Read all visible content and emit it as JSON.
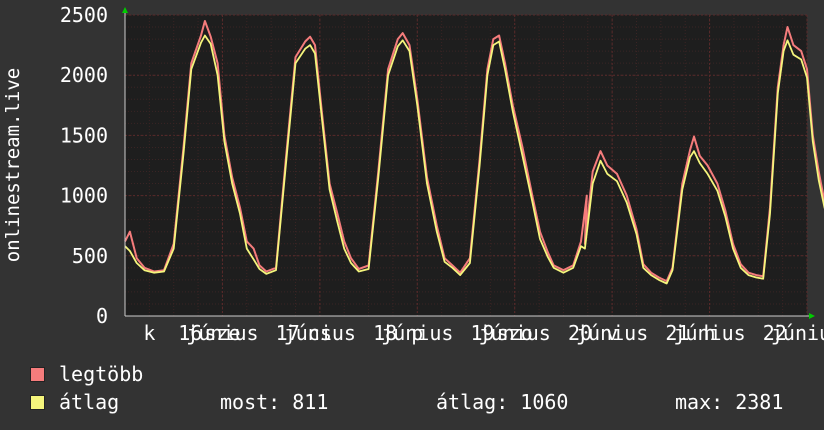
{
  "chart_data": {
    "type": "line",
    "ylabel": "onlinestream.live",
    "ylim": [
      0,
      2500
    ],
    "yticks": [
      0,
      500,
      1000,
      1500,
      2000,
      2500
    ],
    "xlim": [
      0,
      7
    ],
    "x_tick_labels": [
      {
        "x": 0.25,
        "label": "k"
      },
      {
        "x": 0.67,
        "label": "16"
      },
      {
        "x": 1.0,
        "label": "június"
      },
      {
        "x": 1.0,
        "label": "sze"
      },
      {
        "x": 1.67,
        "label": "17"
      },
      {
        "x": 2.0,
        "label": "június"
      },
      {
        "x": 2.0,
        "label": "cs"
      },
      {
        "x": 2.67,
        "label": "18"
      },
      {
        "x": 3.0,
        "label": "június"
      },
      {
        "x": 3.0,
        "label": "p"
      },
      {
        "x": 3.67,
        "label": "19"
      },
      {
        "x": 4.0,
        "label": "június"
      },
      {
        "x": 4.0,
        "label": "szo"
      },
      {
        "x": 4.67,
        "label": "20"
      },
      {
        "x": 5.0,
        "label": "június"
      },
      {
        "x": 5.0,
        "label": "v"
      },
      {
        "x": 5.67,
        "label": "21"
      },
      {
        "x": 6.0,
        "label": "június"
      },
      {
        "x": 6.0,
        "label": "h"
      },
      {
        "x": 6.67,
        "label": "22"
      },
      {
        "x": 7.0,
        "label": "június"
      }
    ],
    "grid": true,
    "series": [
      {
        "name": "legtöbb",
        "color": "#f57c7c",
        "points": [
          [
            0.0,
            620
          ],
          [
            0.05,
            700
          ],
          [
            0.12,
            480
          ],
          [
            0.2,
            400
          ],
          [
            0.3,
            370
          ],
          [
            0.4,
            380
          ],
          [
            0.5,
            600
          ],
          [
            0.6,
            1400
          ],
          [
            0.68,
            2100
          ],
          [
            0.78,
            2330
          ],
          [
            0.82,
            2450
          ],
          [
            0.88,
            2320
          ],
          [
            0.95,
            2100
          ],
          [
            1.02,
            1500
          ],
          [
            1.1,
            1150
          ],
          [
            1.18,
            900
          ],
          [
            1.25,
            620
          ],
          [
            1.32,
            560
          ],
          [
            1.38,
            420
          ],
          [
            1.45,
            370
          ],
          [
            1.55,
            400
          ],
          [
            1.65,
            1300
          ],
          [
            1.75,
            2150
          ],
          [
            1.85,
            2280
          ],
          [
            1.9,
            2320
          ],
          [
            1.95,
            2250
          ],
          [
            2.02,
            1700
          ],
          [
            2.1,
            1100
          ],
          [
            2.18,
            850
          ],
          [
            2.25,
            620
          ],
          [
            2.32,
            480
          ],
          [
            2.4,
            390
          ],
          [
            2.5,
            420
          ],
          [
            2.6,
            1200
          ],
          [
            2.7,
            2050
          ],
          [
            2.8,
            2300
          ],
          [
            2.85,
            2350
          ],
          [
            2.92,
            2250
          ],
          [
            3.0,
            1800
          ],
          [
            3.1,
            1150
          ],
          [
            3.2,
            750
          ],
          [
            3.28,
            480
          ],
          [
            3.36,
            420
          ],
          [
            3.44,
            360
          ],
          [
            3.54,
            480
          ],
          [
            3.64,
            1300
          ],
          [
            3.72,
            2050
          ],
          [
            3.78,
            2300
          ],
          [
            3.84,
            2330
          ],
          [
            3.9,
            2100
          ],
          [
            3.98,
            1750
          ],
          [
            4.08,
            1400
          ],
          [
            4.18,
            1000
          ],
          [
            4.26,
            700
          ],
          [
            4.34,
            530
          ],
          [
            4.4,
            420
          ],
          [
            4.5,
            380
          ],
          [
            4.6,
            420
          ],
          [
            4.68,
            620
          ],
          [
            4.74,
            1000
          ],
          [
            4.72,
            600
          ],
          [
            4.8,
            1200
          ],
          [
            4.88,
            1370
          ],
          [
            4.95,
            1250
          ],
          [
            5.05,
            1180
          ],
          [
            5.15,
            1000
          ],
          [
            5.25,
            720
          ],
          [
            5.32,
            430
          ],
          [
            5.4,
            360
          ],
          [
            5.48,
            320
          ],
          [
            5.56,
            290
          ],
          [
            5.62,
            400
          ],
          [
            5.72,
            1100
          ],
          [
            5.8,
            1380
          ],
          [
            5.84,
            1490
          ],
          [
            5.9,
            1330
          ],
          [
            5.98,
            1250
          ],
          [
            6.08,
            1100
          ],
          [
            6.16,
            880
          ],
          [
            6.24,
            600
          ],
          [
            6.32,
            430
          ],
          [
            6.4,
            360
          ],
          [
            6.48,
            340
          ],
          [
            6.55,
            330
          ],
          [
            6.62,
            900
          ],
          [
            6.7,
            1900
          ],
          [
            6.76,
            2250
          ],
          [
            6.8,
            2400
          ],
          [
            6.86,
            2250
          ],
          [
            6.94,
            2200
          ],
          [
            7.0,
            2050
          ],
          [
            7.06,
            1500
          ],
          [
            7.12,
            1200
          ],
          [
            7.18,
            950
          ],
          [
            7.22,
            850
          ]
        ]
      },
      {
        "name": "átlag",
        "color": "#f5f57c",
        "points": [
          [
            0.0,
            580
          ],
          [
            0.05,
            540
          ],
          [
            0.12,
            440
          ],
          [
            0.2,
            380
          ],
          [
            0.3,
            360
          ],
          [
            0.4,
            370
          ],
          [
            0.5,
            560
          ],
          [
            0.6,
            1350
          ],
          [
            0.68,
            2050
          ],
          [
            0.78,
            2270
          ],
          [
            0.82,
            2330
          ],
          [
            0.88,
            2260
          ],
          [
            0.95,
            2000
          ],
          [
            1.02,
            1450
          ],
          [
            1.1,
            1100
          ],
          [
            1.18,
            850
          ],
          [
            1.25,
            560
          ],
          [
            1.32,
            470
          ],
          [
            1.38,
            390
          ],
          [
            1.45,
            350
          ],
          [
            1.55,
            380
          ],
          [
            1.65,
            1250
          ],
          [
            1.75,
            2100
          ],
          [
            1.85,
            2220
          ],
          [
            1.9,
            2250
          ],
          [
            1.95,
            2180
          ],
          [
            2.02,
            1650
          ],
          [
            2.1,
            1050
          ],
          [
            2.18,
            780
          ],
          [
            2.25,
            560
          ],
          [
            2.32,
            440
          ],
          [
            2.4,
            370
          ],
          [
            2.5,
            390
          ],
          [
            2.6,
            1150
          ],
          [
            2.7,
            2000
          ],
          [
            2.8,
            2240
          ],
          [
            2.85,
            2290
          ],
          [
            2.92,
            2200
          ],
          [
            3.0,
            1750
          ],
          [
            3.1,
            1100
          ],
          [
            3.2,
            700
          ],
          [
            3.28,
            450
          ],
          [
            3.36,
            400
          ],
          [
            3.44,
            340
          ],
          [
            3.54,
            440
          ],
          [
            3.64,
            1250
          ],
          [
            3.72,
            2000
          ],
          [
            3.78,
            2250
          ],
          [
            3.84,
            2280
          ],
          [
            3.9,
            2050
          ],
          [
            3.98,
            1700
          ],
          [
            4.08,
            1330
          ],
          [
            4.18,
            950
          ],
          [
            4.26,
            640
          ],
          [
            4.34,
            490
          ],
          [
            4.4,
            400
          ],
          [
            4.5,
            360
          ],
          [
            4.6,
            400
          ],
          [
            4.68,
            580
          ],
          [
            4.72,
            560
          ],
          [
            4.8,
            1100
          ],
          [
            4.88,
            1290
          ],
          [
            4.95,
            1180
          ],
          [
            5.05,
            1120
          ],
          [
            5.15,
            940
          ],
          [
            5.25,
            680
          ],
          [
            5.32,
            400
          ],
          [
            5.4,
            340
          ],
          [
            5.48,
            300
          ],
          [
            5.56,
            270
          ],
          [
            5.62,
            380
          ],
          [
            5.72,
            1050
          ],
          [
            5.8,
            1320
          ],
          [
            5.84,
            1370
          ],
          [
            5.9,
            1270
          ],
          [
            5.98,
            1180
          ],
          [
            6.08,
            1040
          ],
          [
            6.16,
            830
          ],
          [
            6.24,
            560
          ],
          [
            6.32,
            400
          ],
          [
            6.4,
            340
          ],
          [
            6.48,
            320
          ],
          [
            6.55,
            310
          ],
          [
            6.62,
            850
          ],
          [
            6.7,
            1850
          ],
          [
            6.76,
            2200
          ],
          [
            6.8,
            2290
          ],
          [
            6.86,
            2170
          ],
          [
            6.94,
            2130
          ],
          [
            7.0,
            1980
          ],
          [
            7.06,
            1450
          ],
          [
            7.12,
            1130
          ],
          [
            7.18,
            900
          ],
          [
            7.22,
            800
          ]
        ]
      }
    ]
  },
  "legend": [
    {
      "label": "legtöbb",
      "color": "#f57c7c"
    },
    {
      "label": "átlag",
      "color": "#f5f57c"
    }
  ],
  "stats": {
    "most_label": "most:",
    "most_value": "811",
    "atlag_label": "átlag:",
    "atlag_value": "1060",
    "max_label": "max:",
    "max_value": "2381"
  },
  "colors": {
    "background": "#333333",
    "plot_background": "#1e1e1e",
    "grid": "#5a2a2a",
    "axis_arrow": "#00cc00"
  }
}
